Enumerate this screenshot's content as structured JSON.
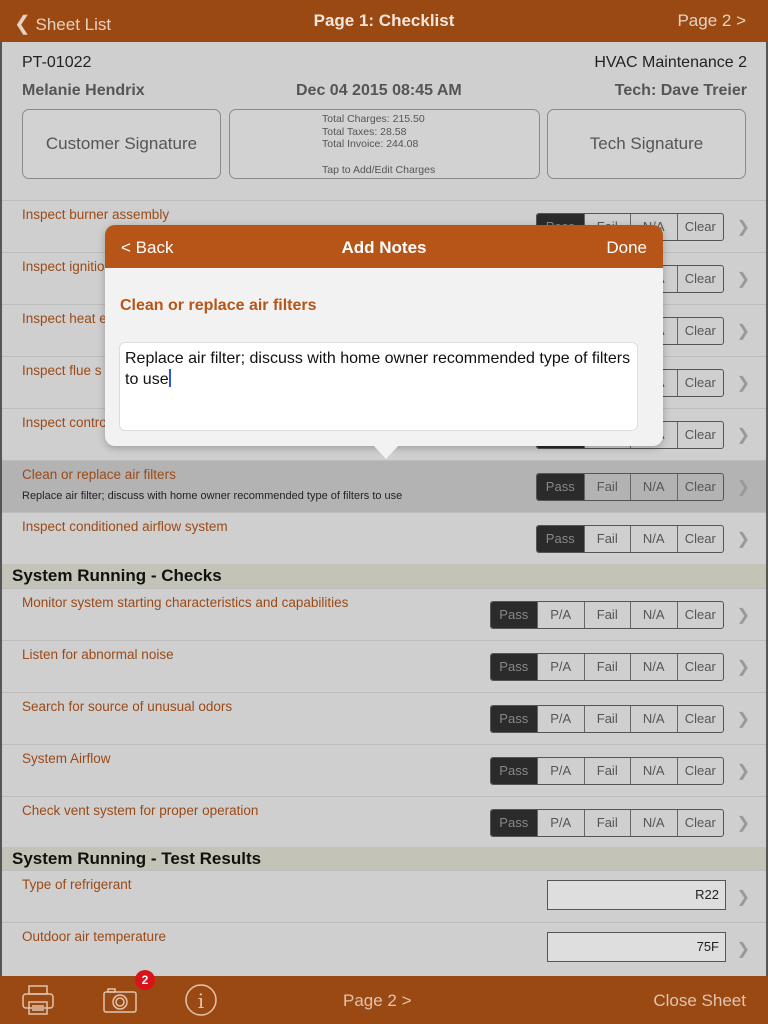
{
  "nav": {
    "back": "Sheet List",
    "title": "Page 1: Checklist",
    "next": "Page 2 >"
  },
  "info": {
    "id": "PT-01022",
    "form": "HVAC Maintenance 2",
    "customer": "Melanie Hendrix",
    "date": "Dec 04 2015 08:45 AM",
    "tech": "Tech: Dave Treier"
  },
  "buttons": {
    "customer_sig": "Customer Signature",
    "tech_sig": "Tech Signature",
    "charges": "Total Charges: 215.50",
    "taxes": "Total Taxes: 28.58",
    "invoice": "Total Invoice: 244.08",
    "charges_hint": "Tap to Add/Edit Charges"
  },
  "rows_a": [
    {
      "label": "Inspect burner assembly",
      "note": "",
      "options": [
        "Pass",
        "Fail",
        "N/A",
        "Clear"
      ],
      "selected": "Pass"
    },
    {
      "label": "Inspect ignitio",
      "note": "",
      "options": [
        "Pass",
        "Fail",
        "N/A",
        "Clear"
      ],
      "selected": "Pass"
    },
    {
      "label": "Inspect heat e",
      "note": "",
      "options": [
        "Pass",
        "Fail",
        "N/A",
        "Clear"
      ],
      "selected": "Pass"
    },
    {
      "label": "Inspect flue s",
      "note": "",
      "options": [
        "Pass",
        "Fail",
        "N/A",
        "Clear"
      ],
      "selected": "Pass"
    },
    {
      "label": "Inspect contro",
      "note": "",
      "options": [
        "Pass",
        "Fail",
        "N/A",
        "Clear"
      ],
      "selected": "Pass"
    },
    {
      "label": "Clean or replace air filters",
      "note": "Replace air filter; discuss with home owner recommended type of filters to use",
      "options": [
        "Pass",
        "Fail",
        "N/A",
        "Clear"
      ],
      "selected": "Pass",
      "highlighted": true
    },
    {
      "label": "Inspect conditioned airflow system",
      "note": "",
      "options": [
        "Pass",
        "Fail",
        "N/A",
        "Clear"
      ],
      "selected": "Pass"
    }
  ],
  "section_checks": "System Running - Checks",
  "rows_b": [
    {
      "label": "Monitor system starting characteristics and capabilities",
      "options": [
        "Pass",
        "P/A",
        "Fail",
        "N/A",
        "Clear"
      ],
      "selected": "Pass"
    },
    {
      "label": "Listen for abnormal noise",
      "options": [
        "Pass",
        "P/A",
        "Fail",
        "N/A",
        "Clear"
      ],
      "selected": "Pass"
    },
    {
      "label": "Search for source of unusual odors",
      "options": [
        "Pass",
        "P/A",
        "Fail",
        "N/A",
        "Clear"
      ],
      "selected": "Pass"
    },
    {
      "label": "System Airflow",
      "options": [
        "Pass",
        "P/A",
        "Fail",
        "N/A",
        "Clear"
      ],
      "selected": "Pass"
    },
    {
      "label": "Check vent system for proper operation",
      "options": [
        "Pass",
        "P/A",
        "Fail",
        "N/A",
        "Clear"
      ],
      "selected": "Pass"
    }
  ],
  "section_results": "System Running - Test Results",
  "rows_c": [
    {
      "label": "Type of refrigerant",
      "value": "R22"
    },
    {
      "label": "Outdoor air temperature",
      "value": "75F"
    }
  ],
  "popover": {
    "back": "< Back",
    "title": "Add Notes",
    "done": "Done",
    "item": "Clean or replace air filters",
    "notes": "Replace air filter; discuss with home owner recommended type of filters to use"
  },
  "footer": {
    "print_icon": "printer-icon",
    "camera_icon": "camera-icon",
    "photo_count": "2",
    "info_icon": "info-icon",
    "next": "Page 2 >",
    "close": "Close Sheet"
  },
  "colors": {
    "brand": "#9b4912",
    "popover_header": "#b65517",
    "label": "#9b4a17"
  }
}
